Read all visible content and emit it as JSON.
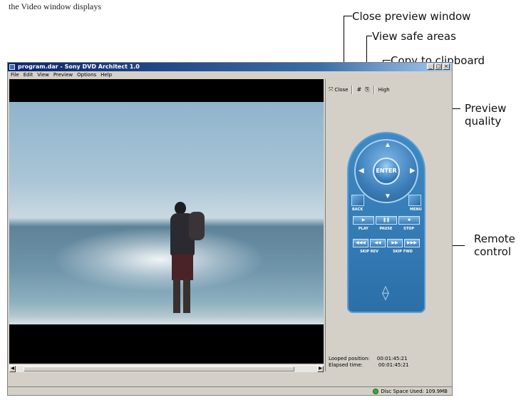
{
  "document": {
    "fragment": "the Video window displays"
  },
  "callouts": {
    "close_preview": "Close preview window",
    "view_safe_areas": "View safe areas",
    "copy_to_clipboard": "Copy to clipboard",
    "preview_quality_line1": "Preview",
    "preview_quality_line2": "quality",
    "remote_control_line1": "Remote",
    "remote_control_line2": "control"
  },
  "window": {
    "title": "program.dar - Sony DVD Architect 1.0",
    "controls": [
      "_",
      "□",
      "×"
    ]
  },
  "menu": [
    "File",
    "Edit",
    "View",
    "Preview",
    "Options",
    "Help"
  ],
  "preview_toolbar": {
    "close_label": "Close",
    "safe_areas_icon": "#",
    "clipboard_icon": "⎘",
    "quality_label": "High"
  },
  "remote": {
    "enter": "ENTER",
    "back": "BACK",
    "menu": "MENU",
    "play": "PLAY",
    "pause": "PAUSE",
    "stop": "STOP",
    "skip_rev": "SKIP REV",
    "skip_fwd": "SKIP FWD",
    "play_glyph": "▶",
    "pause_glyph": "❚❚",
    "stop_glyph": "■",
    "prev_chapter_glyph": "◀◀◀",
    "rew_glyph": "◀◀",
    "ff_glyph": "▶▶",
    "next_chapter_glyph": "▶▶▶"
  },
  "status": {
    "looped_label": "Looped position:",
    "looped_value": "00:01:45:21",
    "elapsed_label": "Elapsed time:",
    "elapsed_value": "00:01:45:21",
    "disc_space": "Disc Space Used: 109.9MB"
  }
}
